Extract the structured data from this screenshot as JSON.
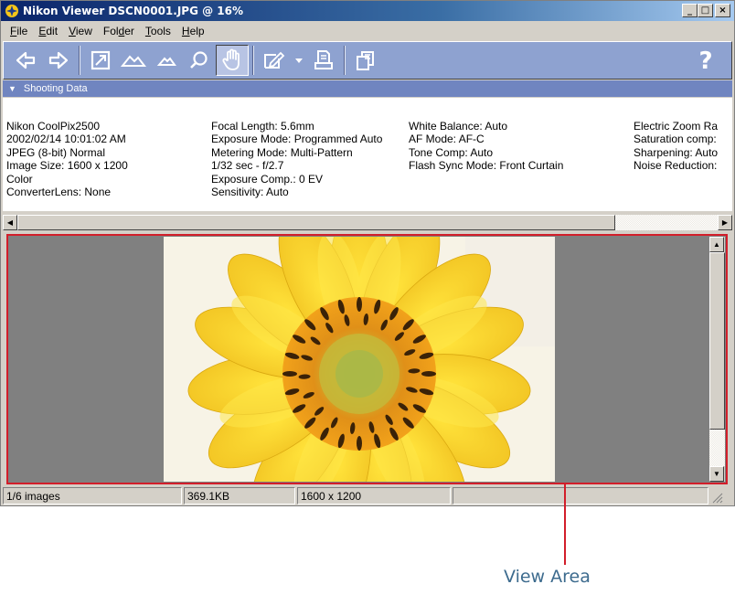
{
  "window": {
    "title": "Nikon Viewer DSCN0001.JPG @ 16%",
    "controls": {
      "minimize": "_",
      "maximize": "□",
      "close": "×"
    }
  },
  "menu": [
    {
      "label": "File",
      "accel": "F",
      "rest": "ile"
    },
    {
      "label": "Edit",
      "accel": "E",
      "rest": "dit"
    },
    {
      "label": "View",
      "accel": "V",
      "rest": "iew"
    },
    {
      "label": "Folder",
      "pre": "Fol",
      "accel": "d",
      "rest": "er"
    },
    {
      "label": "Tools",
      "accel": "T",
      "rest": "ools"
    },
    {
      "label": "Help",
      "accel": "H",
      "rest": "elp"
    }
  ],
  "toolbar": {
    "icons": [
      "previous-icon",
      "next-icon",
      "fit-window-icon",
      "zoom-out-mountain-icon",
      "zoom-in-mountain-icon",
      "magnifier-icon",
      "hand-tool-icon",
      "edit-icon",
      "dropdown-icon",
      "print-icon",
      "copy-icon",
      "help-icon"
    ],
    "help_label": "?"
  },
  "shooting_data": {
    "header": "Shooting Data",
    "columns": [
      [
        "Nikon CoolPix2500",
        "2002/02/14 10:01:02 AM",
        "JPEG (8-bit) Normal",
        "Image Size:  1600 x 1200",
        "Color",
        "ConverterLens: None"
      ],
      [
        "Focal Length: 5.6mm",
        "Exposure Mode: Programmed Auto",
        "Metering Mode: Multi-Pattern",
        "1/32 sec - f/2.7",
        "Exposure Comp.: 0 EV",
        "Sensitivity: Auto"
      ],
      [
        "White Balance: Auto",
        "AF Mode: AF-C",
        "Tone Comp: Auto",
        "Flash Sync Mode: Front Curtain"
      ],
      [
        "Electric Zoom Ra",
        "Saturation comp:",
        "Sharpening: Auto",
        "Noise Reduction:"
      ]
    ]
  },
  "status": {
    "images": "1/6 images",
    "filesize": "369.1KB",
    "dimensions": "1600 x 1200",
    "extra": ""
  },
  "callout": {
    "label": "View Area",
    "color": "#d21e2a"
  },
  "colors": {
    "toolbar_bg": "#8ea2d0",
    "header_bg": "#7085c0",
    "title_gradient_start": "#0a246a"
  }
}
